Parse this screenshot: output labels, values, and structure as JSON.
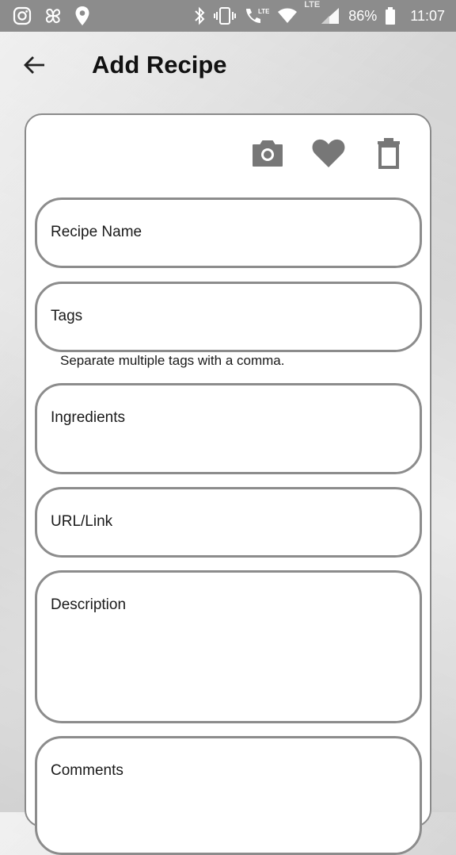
{
  "status_bar": {
    "battery": "86%",
    "time": "11:07",
    "lte_small_1": "LTE",
    "lte_small_2": "LTE"
  },
  "app_bar": {
    "title": "Add Recipe"
  },
  "fields": {
    "recipe_name": "Recipe Name",
    "tags": "Tags",
    "tags_helper": "Separate multiple tags with a comma.",
    "ingredients": "Ingredients",
    "url": "URL/Link",
    "description": "Description",
    "comments": "Comments"
  },
  "icons": {
    "back": "arrow-left-icon",
    "camera": "camera-icon",
    "favorite": "heart-icon",
    "delete": "trash-icon"
  }
}
